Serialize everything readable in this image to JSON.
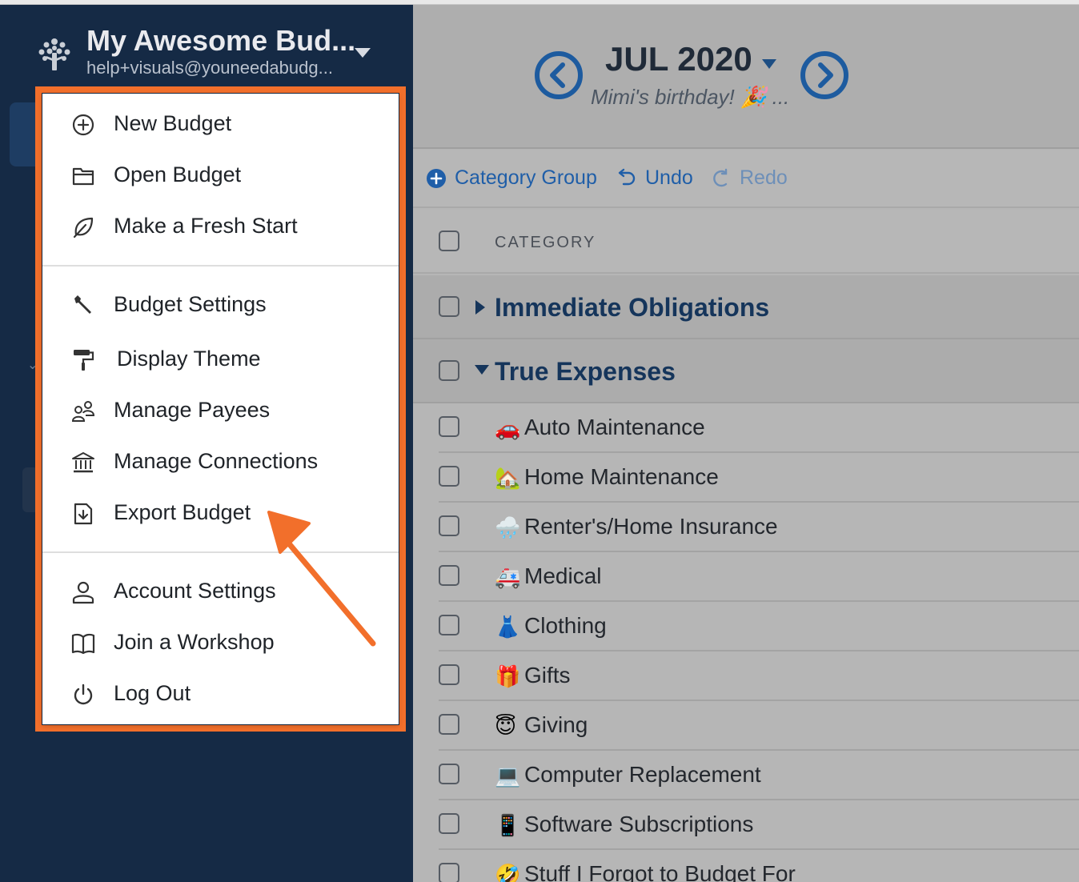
{
  "sidebar": {
    "budget_name": "My Awesome Bud...",
    "budget_email": "help+visuals@youneedabudg..."
  },
  "header": {
    "month": "JUL 2020",
    "month_note": "Mimi's birthday! 🎉 ..."
  },
  "toolbar": {
    "add_group_label": "Category Group",
    "undo_label": "Undo",
    "redo_label": "Redo"
  },
  "table": {
    "column_header": "CATEGORY",
    "groups": [
      {
        "name": "Immediate Obligations",
        "expanded": false
      },
      {
        "name": "True Expenses",
        "expanded": true
      }
    ],
    "categories": [
      {
        "emoji": "🚗",
        "name": "Auto Maintenance"
      },
      {
        "emoji": "🏡",
        "name": "Home Maintenance"
      },
      {
        "emoji": "🌧️",
        "name": "Renter's/Home Insurance"
      },
      {
        "emoji": "🚑",
        "name": "Medical"
      },
      {
        "emoji": "👗",
        "name": "Clothing"
      },
      {
        "emoji": "🎁",
        "name": "Gifts"
      },
      {
        "emoji": "😇",
        "name": "Giving"
      },
      {
        "emoji": "💻",
        "name": "Computer Replacement"
      },
      {
        "emoji": "📱",
        "name": "Software Subscriptions"
      },
      {
        "emoji": "🤣",
        "name": "Stuff I Forgot to Budget For"
      }
    ]
  },
  "menu": {
    "sections": [
      [
        {
          "icon": "plus-circle-icon",
          "label": "New Budget"
        },
        {
          "icon": "folder-icon",
          "label": "Open Budget"
        },
        {
          "icon": "leaf-icon",
          "label": "Make a Fresh Start"
        }
      ],
      [
        {
          "icon": "wrench-icon",
          "label": "Budget Settings"
        },
        {
          "icon": "paint-roller-icon",
          "label": "Display Theme"
        },
        {
          "icon": "payees-icon",
          "label": "Manage Payees"
        },
        {
          "icon": "bank-icon",
          "label": "Manage Connections"
        },
        {
          "icon": "export-icon",
          "label": "Export Budget"
        }
      ],
      [
        {
          "icon": "user-icon",
          "label": "Account Settings"
        },
        {
          "icon": "book-icon",
          "label": "Join a Workshop"
        },
        {
          "icon": "power-icon",
          "label": "Log Out"
        }
      ]
    ]
  },
  "colors": {
    "sidebar_bg": "#152a45",
    "accent_blue": "#1f5ea8",
    "highlight_orange": "#f26f2b",
    "overlay_gray": "#b6b6b6"
  }
}
